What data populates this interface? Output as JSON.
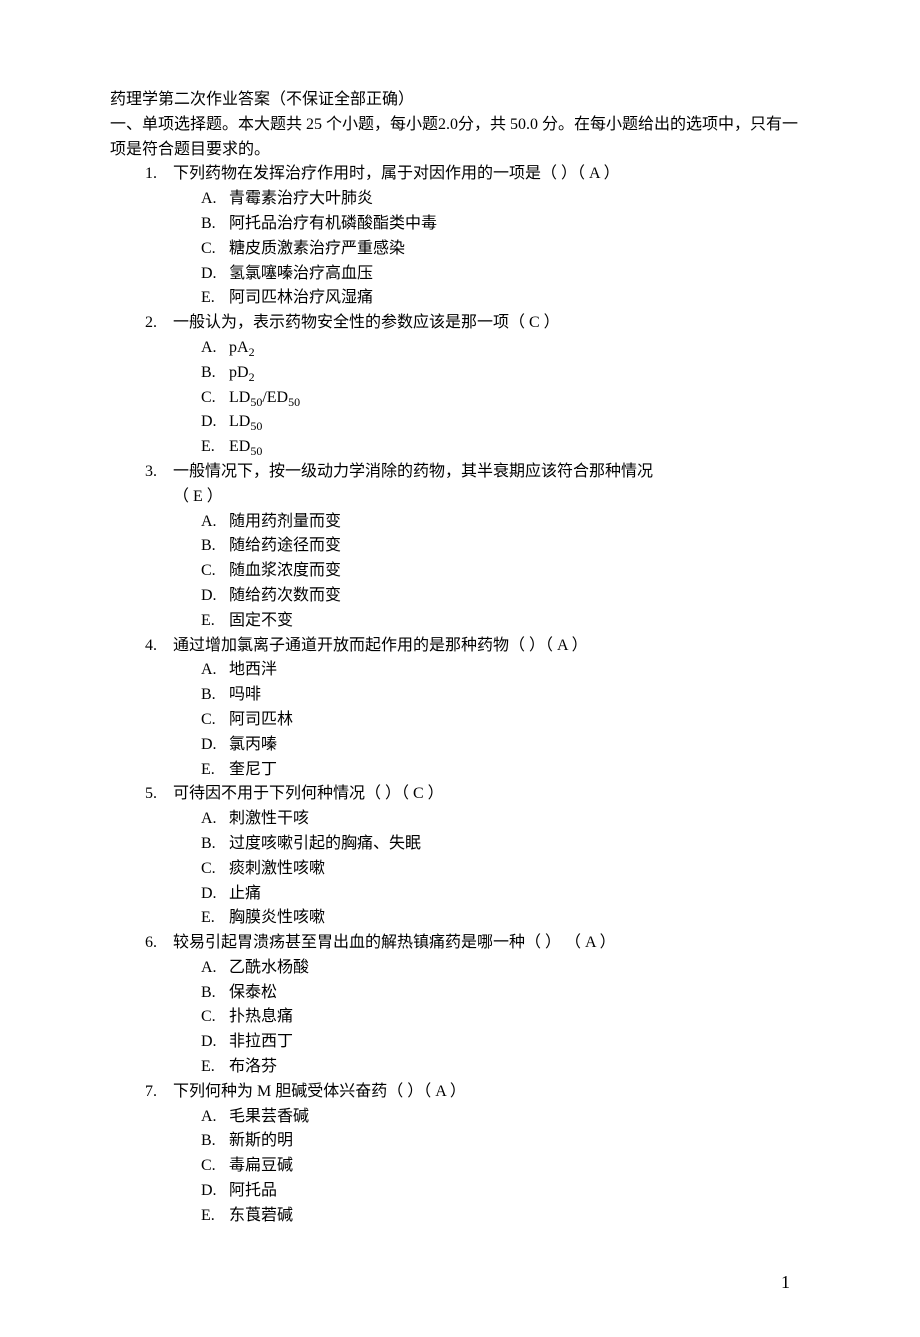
{
  "title": "药理学第二次作业答案（不保证全部正确）",
  "section_instruction": "一、单项选择题。本大题共 25 个小题，每小题2.0分，共 50.0 分。在每小题给出的选项中，只有一项是符合题目要求的。",
  "questions": [
    {
      "num": "1.",
      "stem": "下列药物在发挥治疗作用时，属于对因作用的一项是（ ）（ A ）",
      "options": {
        "A": "青霉素治疗大叶肺炎",
        "B": "阿托品治疗有机磷酸酯类中毒",
        "C": "糖皮质激素治疗严重感染",
        "D": "氢氯噻嗪治疗高血压",
        "E": "阿司匹林治疗风湿痛"
      }
    },
    {
      "num": "2.",
      "stem": "一般认为，表示药物安全性的参数应该是那一项（ C ）",
      "options": {
        "A": "pA",
        "B": "pD",
        "C_pre": "LD",
        "C_mid": "/ED",
        "D": "LD",
        "E": "ED"
      },
      "sub_A": "2",
      "sub_B": "2",
      "sub_C1": "50",
      "sub_C2": "50",
      "sub_D": "50",
      "sub_E": "50"
    },
    {
      "num": "3.",
      "stem": "一般情况下，按一级动力学消除的药物，其半衰期应该符合那种情况",
      "stem2": "（ E ）",
      "options": {
        "A": "随用药剂量而变",
        "B": "随给药途径而变",
        "C": "随血浆浓度而变",
        "D": "随给药次数而变",
        "E": "固定不变"
      }
    },
    {
      "num": "4.",
      "stem": "通过增加氯离子通道开放而起作用的是那种药物（ ）（ A ）",
      "options": {
        "A": "地西泮",
        "B": "吗啡",
        "C": "阿司匹林",
        "D": "氯丙嗪",
        "E": "奎尼丁"
      }
    },
    {
      "num": "5.",
      "stem": "可待因不用于下列何种情况（ ）（ C ）",
      "options": {
        "A": "刺激性干咳",
        "B": "过度咳嗽引起的胸痛、失眠",
        "C": "痰刺激性咳嗽",
        "D": "止痛",
        "E": "胸膜炎性咳嗽"
      }
    },
    {
      "num": "6.",
      "stem": "较易引起胃溃疡甚至胃出血的解热镇痛药是哪一种（ ） （ A ）",
      "options": {
        "A": "乙酰水杨酸",
        "B": "保泰松",
        "C": "扑热息痛",
        "D": "非拉西丁",
        "E": "布洛芬"
      }
    },
    {
      "num": "7.",
      "stem": "下列何种为 M 胆碱受体兴奋药（ ）（ A ）",
      "options": {
        "A": "毛果芸香碱",
        "B": "新斯的明",
        "C": "毒扁豆碱",
        "D": "阿托品",
        "E": "东莨菪碱"
      }
    }
  ],
  "page_number": "1"
}
